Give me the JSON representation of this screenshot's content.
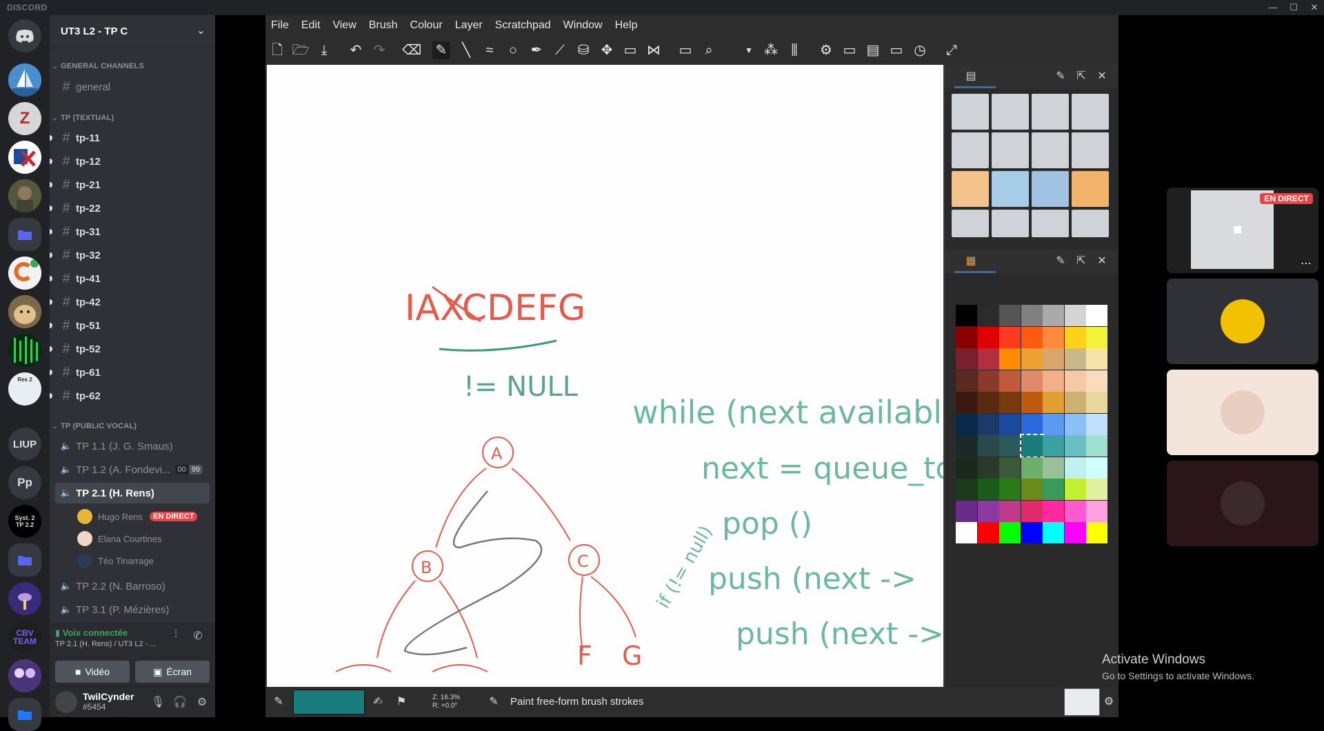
{
  "app_title": "DISCORD",
  "window_controls": {
    "minimize": "—",
    "maximize": "☐",
    "close": "✕"
  },
  "servers": [
    {
      "label": "",
      "icon": "discord-home-icon",
      "color": "#36393f"
    },
    {
      "label": "",
      "icon": "sailboat-avatar",
      "color": "#3a7fbf"
    },
    {
      "label": "Z",
      "icon": "z-logo",
      "color": "#d7d7d7"
    },
    {
      "label": "",
      "icon": "flag-avatar",
      "color": "#1f4c9a"
    },
    {
      "label": "",
      "icon": "soldier-avatar",
      "color": "#6c6a4b"
    },
    {
      "label": "",
      "icon": "folder-icon",
      "color": "#3a4a7a"
    },
    {
      "label": "",
      "icon": "c-logo",
      "color": "#e0e0e0"
    },
    {
      "label": "",
      "icon": "doge-avatar",
      "color": "#c9a465"
    },
    {
      "label": "",
      "icon": "matrix-avatar",
      "color": "#0b3d1d"
    },
    {
      "label": "Res 2",
      "icon": "res2-avatar",
      "color": "#e9eef3"
    },
    {
      "label": "LIUP",
      "icon": "",
      "color": "#36393f"
    },
    {
      "label": "Pp",
      "icon": "",
      "color": "#36393f"
    },
    {
      "label": "Syst. 2 TP 2.2",
      "icon": "",
      "color": "#000000"
    },
    {
      "label": "",
      "icon": "folder-icon",
      "color": "#3a4a7a"
    },
    {
      "label": "",
      "icon": "rocket-avatar",
      "color": "#2b1d5a"
    },
    {
      "label": "CBV TEAM",
      "icon": "",
      "color": "#1e1e1e"
    },
    {
      "label": "",
      "icon": "group-avatar",
      "color": "#5a3f8a"
    },
    {
      "label": "",
      "icon": "folder-icon",
      "color": "#1f5dc4"
    }
  ],
  "guild": {
    "name": "UT3 L2 - TP C"
  },
  "categories": {
    "general": "GENERAL CHANNELS",
    "textual": "TP (TEXTUAL)",
    "vocal": "TP (PUBLIC VOCAL)"
  },
  "general_channel": "general",
  "text_channels": [
    "tp-11",
    "tp-12",
    "tp-21",
    "tp-22",
    "tp-31",
    "tp-32",
    "tp-41",
    "tp-42",
    "tp-51",
    "tp-52",
    "tp-61",
    "tp-62"
  ],
  "voice_channels": [
    {
      "label": "TP 1.1 (J. G. Smaus)"
    },
    {
      "label": "TP 1.2 (A. Fondevi...",
      "badge1": "00",
      "badge2": "99"
    },
    {
      "label": "TP 2.1 (H. Rens)"
    },
    {
      "label": "TP 2.2 (N. Barroso)"
    },
    {
      "label": "TP 3.1 (P. Mézières)"
    }
  ],
  "voice_users": [
    {
      "name": "Hugo Rens",
      "live": "EN DIRECT"
    },
    {
      "name": "Elana Courtines"
    },
    {
      "name": "Téo Tinarrage"
    }
  ],
  "voice_panel": {
    "status": "Voix connectée",
    "channel": "TP 2.1 (H. Rens) / UT3 L2 - ...",
    "video": "Vidéo",
    "screen": "Écran"
  },
  "user": {
    "name": "TwilCynder",
    "tag": "#5454"
  },
  "krita": {
    "menus": [
      "File",
      "Edit",
      "View",
      "Brush",
      "Colour",
      "Layer",
      "Scratchpad",
      "Window",
      "Help"
    ],
    "status_hint": "Paint free-form brush strokes",
    "zoom": "Z: 16.3%",
    "rotation": "R: +0.0°",
    "fg_color": "#1a7d7d"
  },
  "canvas_text": {
    "letters": "IAXCDEFG",
    "notnull": "!= NULL",
    "line1": "while (next available)",
    "line2": "next = queue_to",
    "line3": "pop ()",
    "line4": "push (next ->",
    "line5": "push (next -> r",
    "cond": "if (!= null)",
    "nodeA": "A",
    "nodeB": "B",
    "nodeC": "C",
    "nodeF": "F",
    "nodeG": "G"
  },
  "tiles": [
    {
      "live": "EN DIRECT"
    },
    {},
    {},
    {}
  ],
  "activate": {
    "title": "Activate Windows",
    "subtitle": "Go to Settings to activate Windows."
  }
}
